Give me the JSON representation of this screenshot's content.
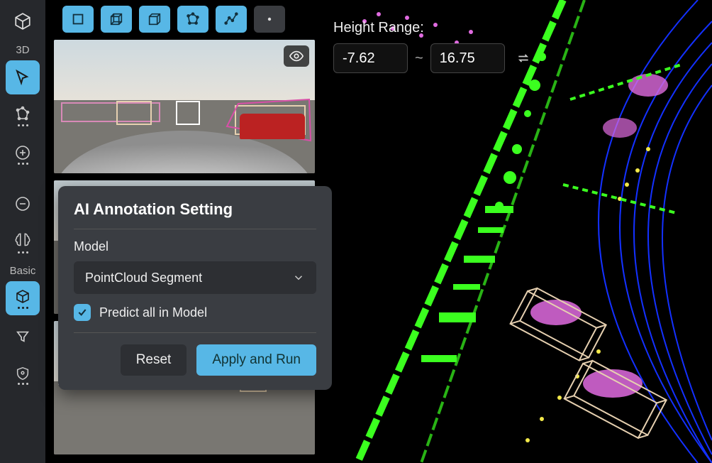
{
  "sidebar": {
    "mode_label": "3D",
    "group_label": "Basic"
  },
  "toolbar": {
    "shapes": [
      "rect-2d",
      "cube-3d",
      "cube-alt-3d",
      "poly-3d",
      "polyline"
    ]
  },
  "height_range": {
    "label": "Height Range:",
    "min": "-7.62",
    "max": "16.75"
  },
  "modal": {
    "title": "AI Annotation Setting",
    "field_label": "Model",
    "selected_model": "PointCloud Segment",
    "predict_all_label": "Predict all in Model",
    "predict_all_checked": true,
    "reset_label": "Reset",
    "apply_label": "Apply and Run"
  },
  "cameras": {
    "tiles": [
      "front",
      "left",
      "rear"
    ]
  }
}
